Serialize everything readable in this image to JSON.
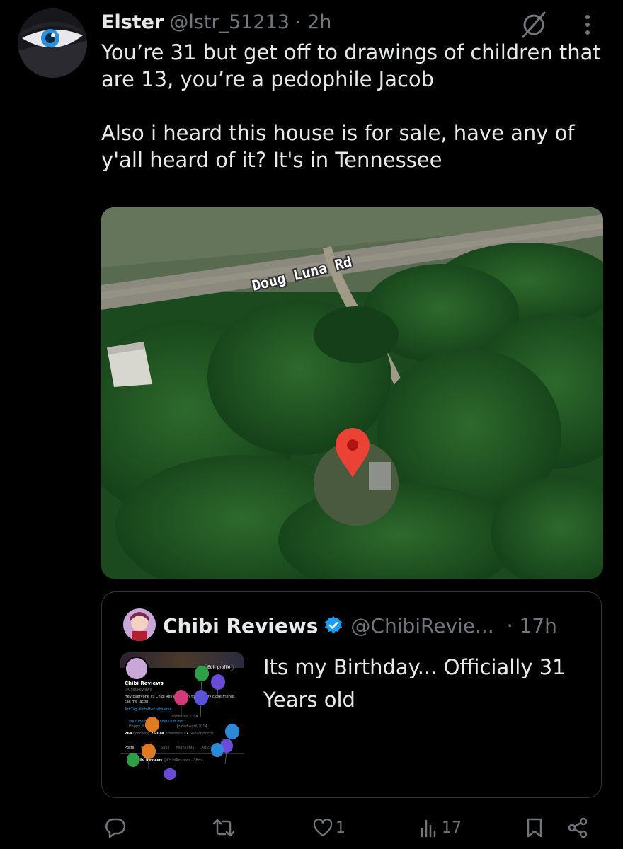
{
  "tweet": {
    "author_name": "Elster",
    "author_handle": "@lstr_51213",
    "time": "· 2h",
    "text_line_1": "You’re 31 but get off to drawings of children that are 13, you’re a pedophile Jacob",
    "text_line_2": "Also i heard this house is for sale, have any of y'all heard of it? It's in Tennessee"
  },
  "map": {
    "road_label": "Doug Luna Rd"
  },
  "quote": {
    "author_name": "Chibi Reviews",
    "verified": true,
    "author_handle": "@ChibiRevie...",
    "time": "· 17h",
    "text": "Its my Birthday... Officially 31 Years old",
    "thumbnail": {
      "edit_profile": "Edit profile",
      "name": "Chibi Reviews",
      "handle": "@ChibiReviews",
      "bio": "Hey Everyone its Chibi Reviews from Youtube My close friends call me Jacob",
      "art_tag": "Art Tag #intothechibiverse",
      "location": "Tennessee, USA",
      "link": "youtube.com/channel/UCfCme...",
      "birthday": "Happy Birthday!",
      "joined": "Joined April 2014",
      "following": "264",
      "following_label": "Following",
      "followers": "250.8K",
      "followers_label": "Followers",
      "subs": "17",
      "subs_label": "Subscriptions",
      "tabs": [
        "Posts",
        "Replies",
        "Subs",
        "Highlights",
        "Articles"
      ],
      "post_author": "Chibi Reviews",
      "post_handle": "@ChibiReviews · 38m"
    }
  },
  "actions": {
    "reply_count": "",
    "repost_count": "",
    "like_count": "1",
    "views_count": "17"
  },
  "colors": {
    "background": "#000000",
    "text": "#e7e9ea",
    "secondary": "#71767b",
    "verified": "#1d9bf0",
    "pin": "#ea4335"
  }
}
